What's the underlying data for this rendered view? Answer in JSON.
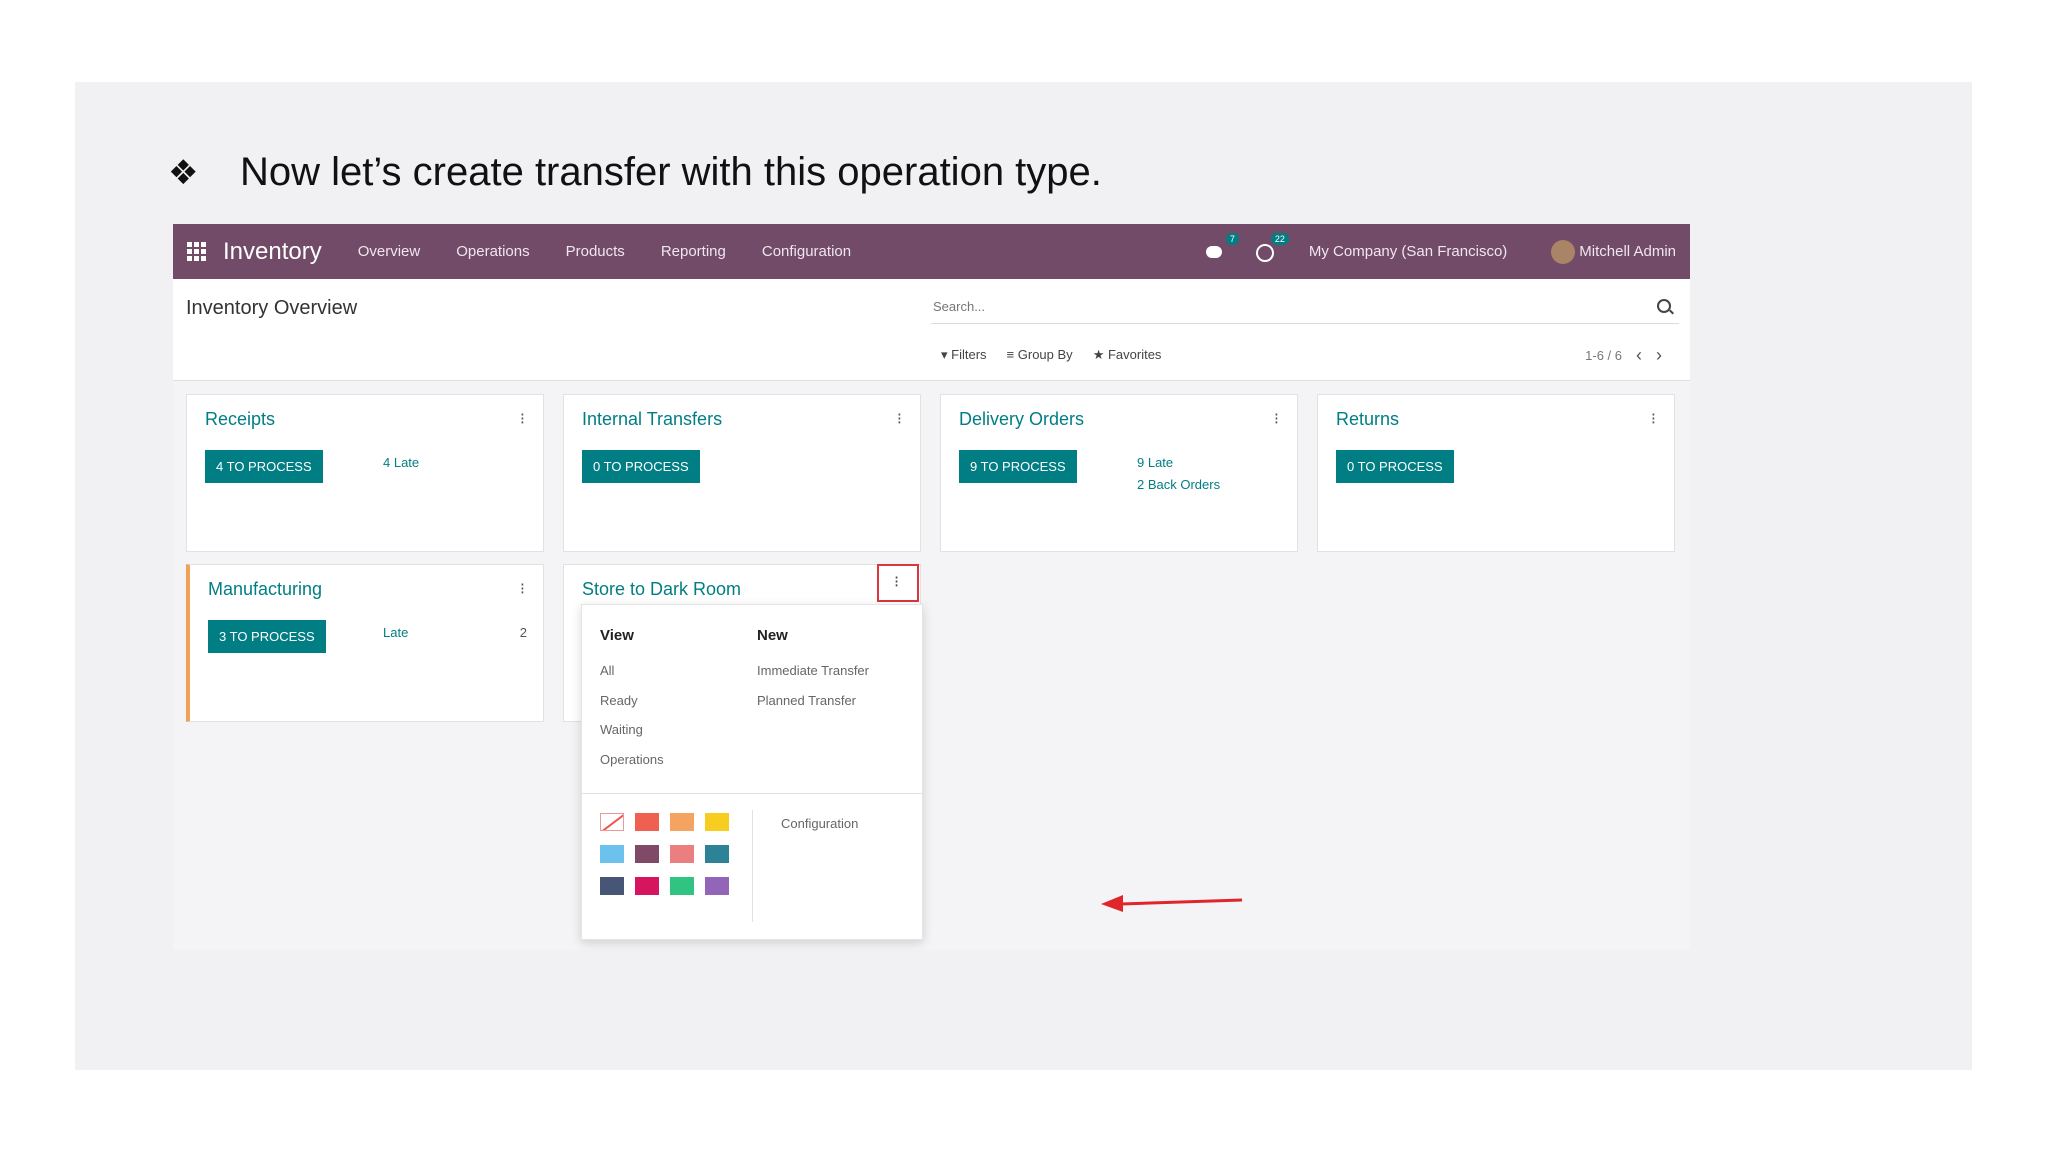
{
  "slide": {
    "bullet_symbol": "❖",
    "bullet_text": "Now let’s create transfer with this operation type."
  },
  "navbar": {
    "app_name": "Inventory",
    "menu": [
      "Overview",
      "Operations",
      "Products",
      "Reporting",
      "Configuration"
    ],
    "chat_badge": "7",
    "activity_badge": "22",
    "company": "My Company (San Francisco)",
    "user": "Mitchell Admin"
  },
  "control_panel": {
    "title": "Inventory Overview",
    "search_placeholder": "Search...",
    "filters": "Filters",
    "group_by": "Group By",
    "favorites": "Favorites",
    "pager": "1-6 / 6"
  },
  "cards": [
    {
      "title": "Receipts",
      "button": "4 TO PROCESS",
      "stats": [
        "4 Late"
      ]
    },
    {
      "title": "Internal Transfers",
      "button": "0 TO PROCESS",
      "stats": []
    },
    {
      "title": "Delivery Orders",
      "button": "9 TO PROCESS",
      "stats": [
        "9 Late",
        "2 Back Orders"
      ]
    },
    {
      "title": "Returns",
      "button": "0 TO PROCESS",
      "stats": []
    },
    {
      "title": "Manufacturing",
      "button": "3 TO PROCESS",
      "stats": [
        "Late"
      ],
      "stat_count": "2"
    },
    {
      "title": "Store to Dark Room"
    }
  ],
  "dropdown": {
    "view_header": "View",
    "view_items": [
      "All",
      "Ready",
      "Waiting",
      "Operations"
    ],
    "new_header": "New",
    "new_items": [
      "Immediate Transfer",
      "Planned Transfer"
    ],
    "configuration": "Configuration",
    "colors": [
      "none",
      "#f06050",
      "#f4a460",
      "#f7cd1f",
      "#6cc1ed",
      "#814968",
      "#eb7e7f",
      "#2c8397",
      "#475577",
      "#d6145f",
      "#30c381",
      "#9365b8"
    ]
  },
  "colors": {
    "brand": "#714b67",
    "accent": "#017e84",
    "highlight": "#d9363e",
    "manufacturing_border": "#f0a356"
  }
}
